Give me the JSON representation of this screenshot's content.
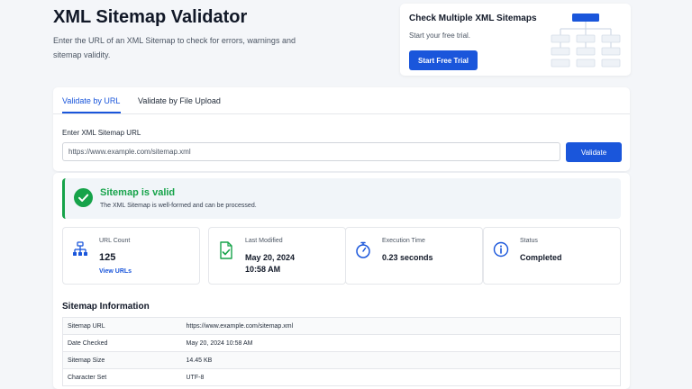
{
  "hero": {
    "title": "XML Sitemap Validator",
    "description": "Enter the URL of an XML Sitemap to check for errors, warnings and sitemap validity."
  },
  "promo": {
    "title": "Check Multiple XML Sitemaps",
    "subtitle": "Start your free trial.",
    "button_label": "Start Free Trial",
    "icon": "sitemap-diagram-icon"
  },
  "tabs": [
    {
      "label": "Validate by URL",
      "active": true
    },
    {
      "label": "Validate by File Upload",
      "active": false
    }
  ],
  "form": {
    "label": "Enter XML Sitemap URL",
    "value": "https://www.example.com/sitemap.xml",
    "button_label": "Validate"
  },
  "result": {
    "title": "Sitemap is valid",
    "description": "The XML Sitemap is well-formed and can be processed.",
    "icon": "check-circle-icon"
  },
  "stats": {
    "url_count": {
      "label": "URL Count",
      "value": "125",
      "link": "View URLs",
      "icon": "sitemap-icon"
    },
    "last_modified": {
      "label": "Last Modified",
      "date": "May 20, 2024",
      "time": "10:58 AM",
      "icon": "file-check-icon"
    },
    "execution_time": {
      "label": "Execution Time",
      "value": "0.23 seconds",
      "icon": "stopwatch-icon"
    },
    "status": {
      "label": "Status",
      "value": "Completed",
      "icon": "info-icon"
    }
  },
  "info": {
    "title": "Sitemap Information",
    "rows": [
      {
        "key": "Sitemap URL",
        "value": "https://www.example.com/sitemap.xml"
      },
      {
        "key": "Date Checked",
        "value": "May 20, 2024 10:58 AM"
      },
      {
        "key": "Sitemap Size",
        "value": "14.45 KB"
      },
      {
        "key": "Character Set",
        "value": "UTF-8"
      }
    ]
  },
  "colors": {
    "accent": "#1a56db",
    "success": "#16a34a",
    "background": "#f4f6f9"
  }
}
